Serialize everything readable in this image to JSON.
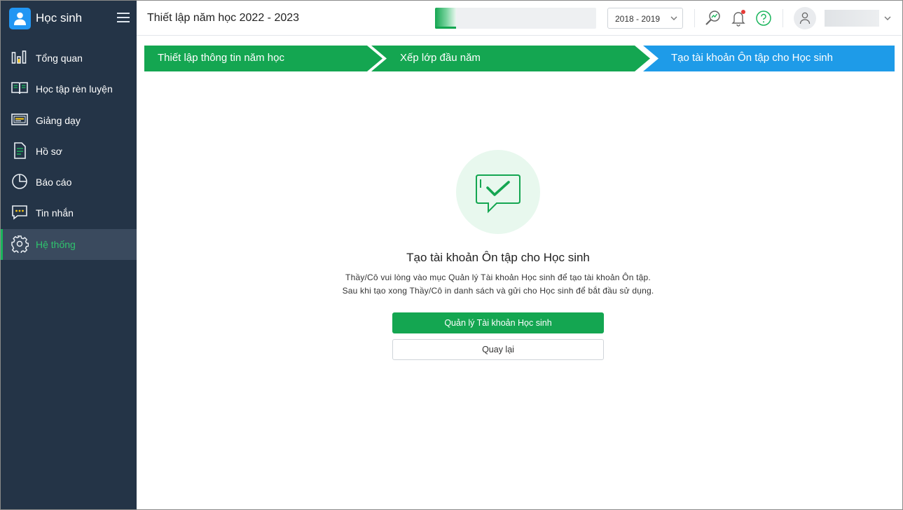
{
  "sidebar": {
    "brand": {
      "title": "Học sinh",
      "logo_color": "#2196f3"
    },
    "items": [
      {
        "label": "Tổng quan",
        "icon": "bar-chart-icon"
      },
      {
        "label": "Học tập rèn luyện",
        "icon": "open-book-icon"
      },
      {
        "label": "Giảng dạy",
        "icon": "board-icon"
      },
      {
        "label": "Hồ sơ",
        "icon": "document-icon"
      },
      {
        "label": "Báo cáo",
        "icon": "pie-chart-icon"
      },
      {
        "label": "Tin nhắn",
        "icon": "chat-bubble-icon"
      },
      {
        "label": "Hệ thống",
        "icon": "gear-icon",
        "active": true
      }
    ]
  },
  "header": {
    "title": "Thiết lập năm học 2022 - 2023",
    "progress": 0.13,
    "year_select": {
      "value": "2018 - 2019"
    },
    "icons": [
      "magnify-chart-icon",
      "bell-icon",
      "help-icon",
      "user-avatar-icon",
      "chevron-down-icon"
    ]
  },
  "stepper": {
    "steps": [
      {
        "label": "Thiết lập thông tin năm học",
        "state": "done"
      },
      {
        "label": "Xếp lớp đầu năm",
        "state": "done"
      },
      {
        "label": "Tạo tài khoản Ôn tập cho Học sinh",
        "state": "active"
      }
    ]
  },
  "content": {
    "icon": "chat-check-icon",
    "title": "Tạo tài khoản Ôn tập cho Học sinh",
    "desc_line1": "Thầy/Cô vui lòng vào mục Quản lý Tài khoản Học sinh để tạo tài khoản Ôn tập.",
    "desc_line2": "Sau khi tạo xong Thầy/Cô in danh sách và gửi cho Học sinh để bắt đầu sử dụng.",
    "primary_button": "Quản lý Tài khoản Học sinh",
    "secondary_button": "Quay lại"
  },
  "colors": {
    "sidebar_bg": "#243447",
    "accent_green": "#14a651",
    "active_step_blue": "#1e9be8",
    "active_nav_text": "#2fc46e",
    "notification_dot": "#e53935"
  }
}
